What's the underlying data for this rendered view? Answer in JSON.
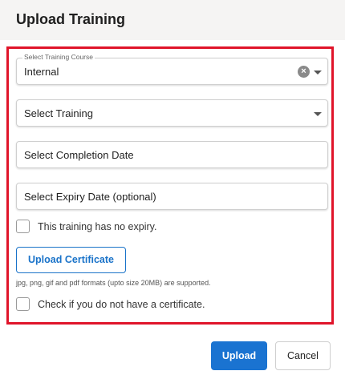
{
  "dialog": {
    "title": "Upload Training"
  },
  "form": {
    "course": {
      "legend": "Select Training Course",
      "value": "Internal"
    },
    "training": {
      "placeholder": "Select Training"
    },
    "completion_date": {
      "placeholder": "Select Completion Date"
    },
    "expiry_date": {
      "placeholder": "Select Expiry Date (optional)"
    },
    "no_expiry": {
      "label": "This training has no expiry.",
      "checked": false
    },
    "upload_certificate_label": "Upload Certificate",
    "formats_hint": "jpg, png, gif and pdf formats (upto size 20MB) are supported.",
    "no_certificate": {
      "label": "Check if you do not have a certificate.",
      "checked": false
    }
  },
  "footer": {
    "upload_label": "Upload",
    "cancel_label": "Cancel"
  },
  "colors": {
    "accent": "#1a73d1",
    "highlight_border": "#e0142a"
  }
}
